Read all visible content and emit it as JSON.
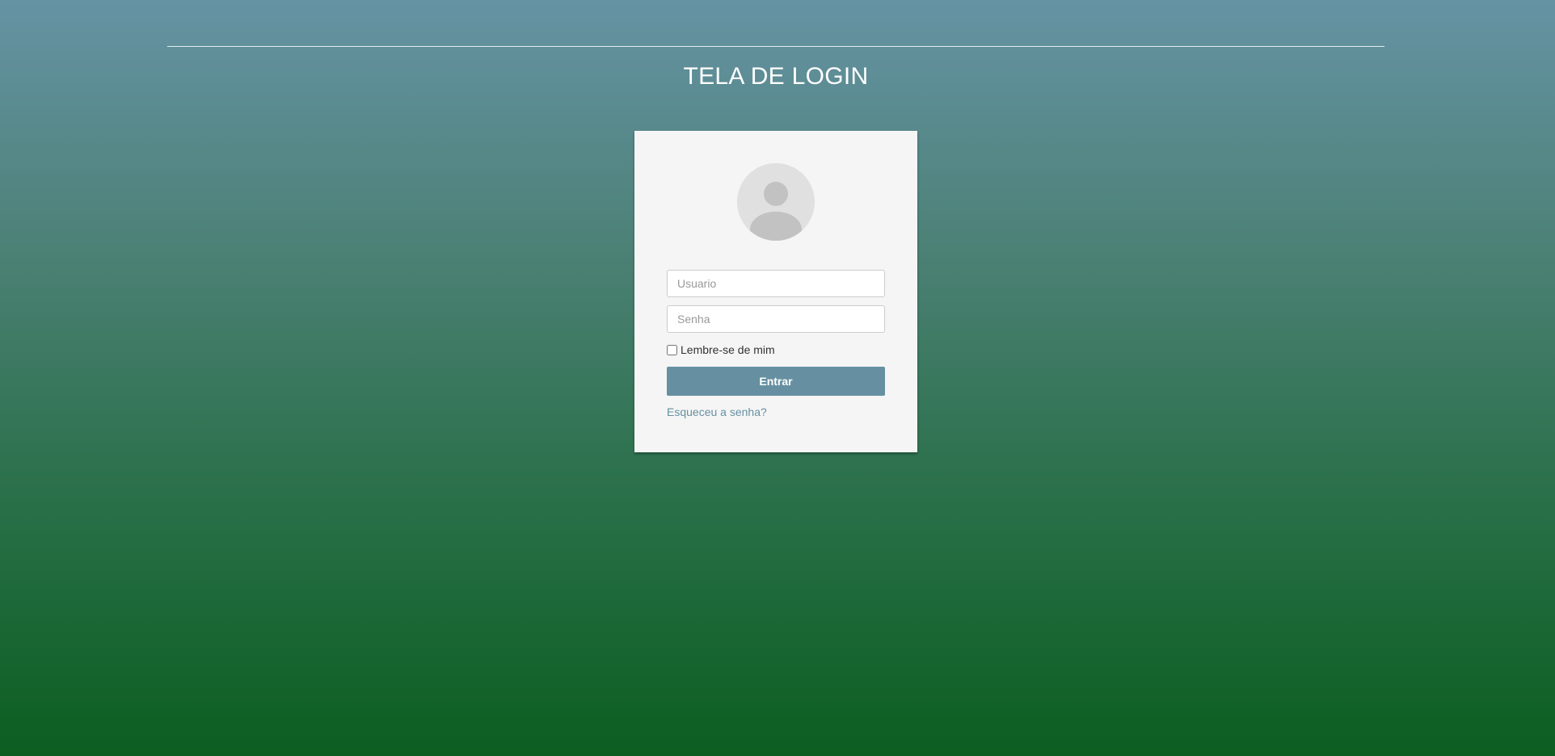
{
  "header": {
    "title": "TELA DE LOGIN"
  },
  "login": {
    "avatar_icon": "user-avatar-icon",
    "username_placeholder": "Usuario",
    "password_placeholder": "Senha",
    "remember_label": "Lembre-se de mim",
    "remember_checked": false,
    "submit_label": "Entrar",
    "forgot_label": "Esqueceu a senha?"
  },
  "colors": {
    "background_top": "#6693a4",
    "background_bottom": "#0b5e20",
    "card_background": "#f5f5f5",
    "button": "#6690a1",
    "link": "#6690a1"
  }
}
